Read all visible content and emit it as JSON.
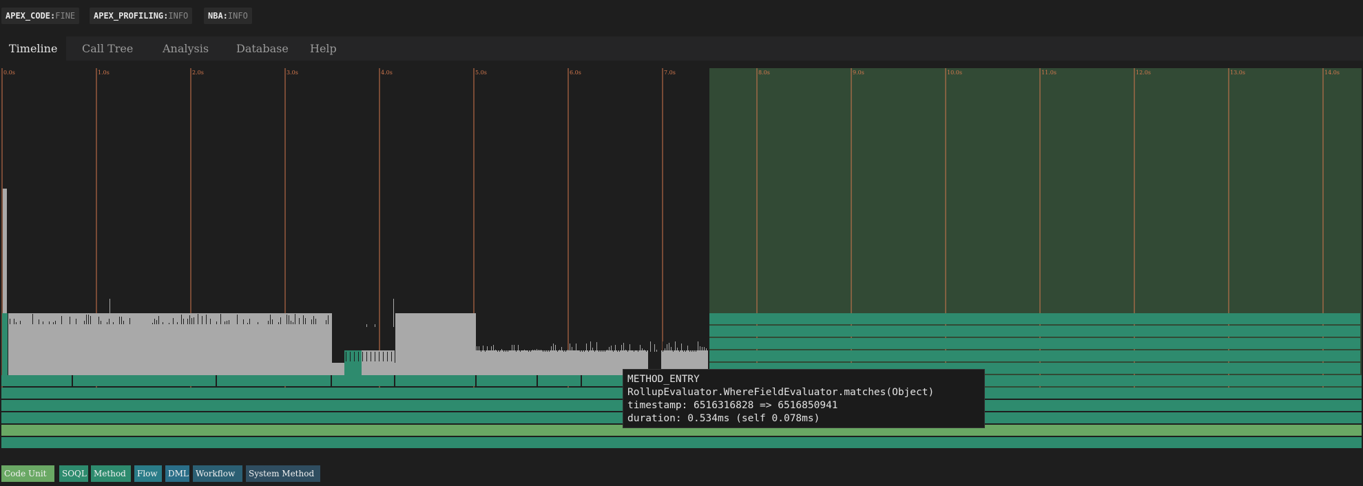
{
  "log_levels": [
    {
      "key": "APEX_CODE:",
      "value": "FINE"
    },
    {
      "key": "APEX_PROFILING:",
      "value": "INFO"
    },
    {
      "key": "NBA:",
      "value": "INFO"
    }
  ],
  "tabs": [
    {
      "label": "Timeline",
      "active": true
    },
    {
      "label": "Call Tree",
      "active": false
    },
    {
      "label": "Analysis",
      "active": false
    },
    {
      "label": "Database",
      "active": false
    },
    {
      "label": "Help",
      "active": false
    }
  ],
  "timeline": {
    "ticks": [
      "0.0s",
      "1.0s",
      "2.0s",
      "3.0s",
      "4.0s",
      "5.0s",
      "6.0s",
      "7.0s",
      "8.0s",
      "9.0s",
      "10.0s",
      "11.0s",
      "12.0s",
      "13.0s",
      "14.0s"
    ],
    "colors": {
      "background": "#1e1e1e",
      "tick_line": "#d4784e",
      "selection": "#324a35",
      "code_unit": "#6aa864",
      "method": "#2e8b6e",
      "frames": "#a9a9a9"
    }
  },
  "tooltip": {
    "type": "METHOD_ENTRY",
    "name": "RollupEvaluator.WhereFieldEvaluator.matches(Object)",
    "timestamp": "timestamp: 6516316828 => 6516850941",
    "duration": "duration: 0.534ms (self 0.078ms)"
  },
  "legend": [
    {
      "label": "Code Unit",
      "color": "#6aa864"
    },
    {
      "label": "SOQL",
      "color": "#2e8b6e"
    },
    {
      "label": "Method",
      "color": "#2e8b6e"
    },
    {
      "label": "Flow",
      "color": "#2a7c88"
    },
    {
      "label": "DML",
      "color": "#2a6e88"
    },
    {
      "label": "Workflow",
      "color": "#2b5f73"
    },
    {
      "label": "System Method",
      "color": "#2f4d60"
    }
  ]
}
